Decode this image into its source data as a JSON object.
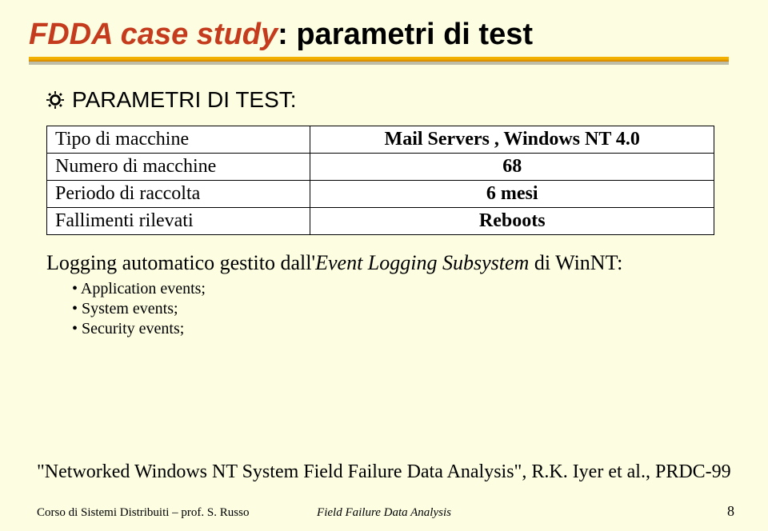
{
  "title": {
    "part1": "FDDA case study",
    "sep": ": ",
    "part2": "parametri di test"
  },
  "subtitle": "PARAMETRI DI TEST:",
  "table": {
    "rows": [
      {
        "label": "Tipo di macchine",
        "value": "Mail Servers , Windows NT 4.0"
      },
      {
        "label": "Numero di macchine",
        "value": "68"
      },
      {
        "label": "Periodo di raccolta",
        "value": "6 mesi"
      },
      {
        "label": "Fallimenti rilevati",
        "value": "Reboots"
      }
    ]
  },
  "logging": {
    "prefix": "Logging automatico gestito dall'",
    "emph": "Event Logging Subsystem",
    "suffix": " di WinNT:",
    "bullets": [
      "Application events;",
      "System events;",
      "Security events;"
    ]
  },
  "citation": "\"Networked Windows NT System Field Failure Data Analysis\", R.K. Iyer et al., PRDC-99",
  "footer": {
    "left": "Corso di Sistemi Distribuiti – prof. S. Russo",
    "center": "Field Failure Data Analysis",
    "page": "8"
  }
}
